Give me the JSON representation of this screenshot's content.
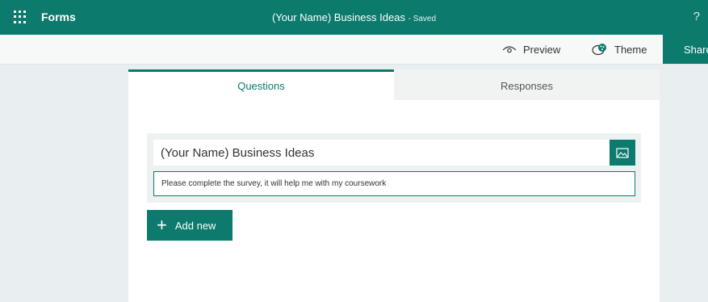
{
  "app": {
    "name": "Forms",
    "doc_title": "(Your Name) Business Ideas",
    "status": "- Saved",
    "help": "?"
  },
  "commands": {
    "preview": "Preview",
    "theme": "Theme",
    "share": "Share"
  },
  "tabs": [
    {
      "label": "Questions",
      "active": true
    },
    {
      "label": "Responses",
      "active": false
    }
  ],
  "form": {
    "title": "(Your Name) Business Ideas",
    "description": "Please complete the survey, it will help me with my coursework",
    "add_new": "Add new"
  },
  "colors": {
    "accent": "#0c7a6d",
    "background": "#e9eef0"
  }
}
